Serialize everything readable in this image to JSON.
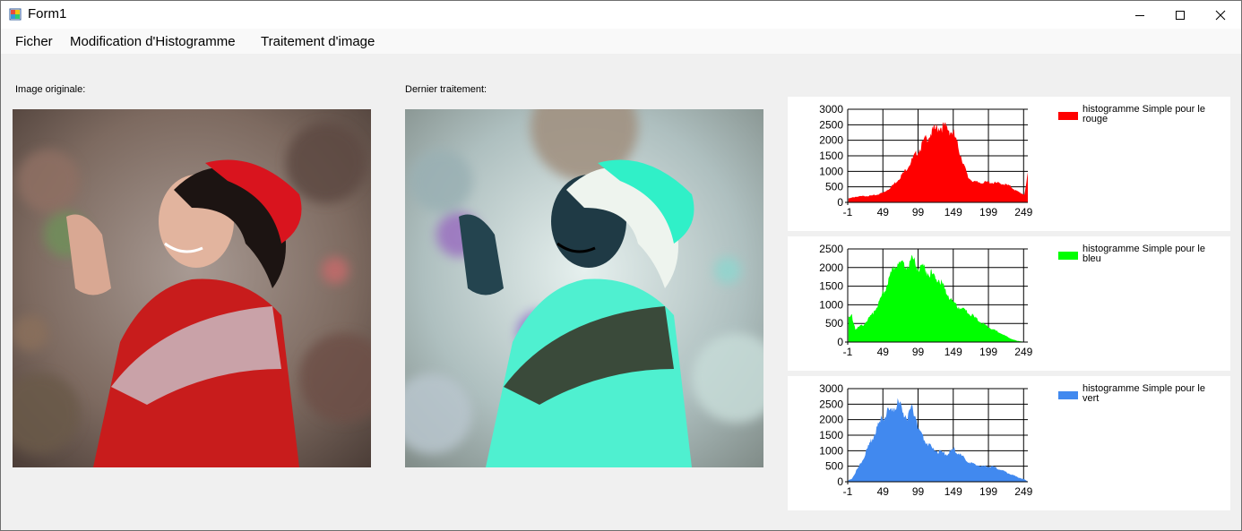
{
  "window": {
    "title": "Form1"
  },
  "menu": [
    {
      "label": "Ficher"
    },
    {
      "label": "Modification d'Histogramme"
    },
    {
      "label": "Traitement d'image"
    }
  ],
  "labels": {
    "original": "Image originale:",
    "processed": "Dernier traitement:"
  },
  "chart_data": [
    {
      "type": "area",
      "color": "#ff0000",
      "legend": "histogramme Simple pour le rouge",
      "x_ticks": [
        -1,
        49,
        99,
        149,
        199,
        249
      ],
      "y_ticks": [
        0,
        500,
        1000,
        1500,
        2000,
        2500,
        3000
      ],
      "xlim": [
        -1,
        255
      ],
      "ylim": [
        0,
        3000
      ],
      "x": [
        0,
        10,
        20,
        30,
        40,
        50,
        60,
        70,
        80,
        90,
        100,
        110,
        120,
        130,
        140,
        150,
        160,
        170,
        180,
        190,
        200,
        210,
        220,
        230,
        240,
        250,
        255
      ],
      "values": [
        120,
        180,
        200,
        210,
        240,
        320,
        480,
        720,
        1000,
        1350,
        1700,
        2050,
        2300,
        2450,
        2400,
        2200,
        1500,
        800,
        650,
        640,
        650,
        620,
        600,
        520,
        350,
        250,
        900
      ]
    },
    {
      "type": "area",
      "color": "#00ff00",
      "legend": "histogramme Simple pour le bleu",
      "x_ticks": [
        -1,
        49,
        99,
        149,
        199,
        249
      ],
      "y_ticks": [
        0,
        500,
        1000,
        1500,
        2000,
        2500
      ],
      "xlim": [
        -1,
        255
      ],
      "ylim": [
        0,
        2500
      ],
      "x": [
        0,
        5,
        10,
        20,
        30,
        40,
        50,
        60,
        70,
        80,
        90,
        100,
        110,
        120,
        130,
        140,
        150,
        160,
        170,
        180,
        190,
        200,
        210,
        220,
        230,
        240,
        250,
        255
      ],
      "values": [
        650,
        700,
        350,
        450,
        650,
        950,
        1350,
        1800,
        2150,
        2050,
        2200,
        2000,
        1950,
        1800,
        1650,
        1300,
        1050,
        900,
        800,
        650,
        500,
        400,
        300,
        200,
        100,
        30,
        10,
        0
      ]
    },
    {
      "type": "area",
      "color": "#4189ef",
      "legend": "histogramme Simple pour le vert",
      "x_ticks": [
        -1,
        49,
        99,
        149,
        199,
        249
      ],
      "y_ticks": [
        0,
        500,
        1000,
        1500,
        2000,
        2500,
        3000
      ],
      "xlim": [
        -1,
        255
      ],
      "ylim": [
        0,
        3000
      ],
      "x": [
        0,
        5,
        10,
        20,
        30,
        40,
        50,
        60,
        70,
        80,
        85,
        90,
        95,
        100,
        110,
        120,
        130,
        140,
        150,
        160,
        170,
        180,
        190,
        200,
        210,
        220,
        230,
        240,
        250,
        255
      ],
      "values": [
        50,
        100,
        300,
        700,
        1200,
        1700,
        2100,
        2300,
        2550,
        2200,
        2100,
        2400,
        2200,
        1700,
        1300,
        1050,
        950,
        900,
        1050,
        850,
        650,
        550,
        500,
        500,
        450,
        350,
        250,
        150,
        80,
        0
      ]
    }
  ]
}
